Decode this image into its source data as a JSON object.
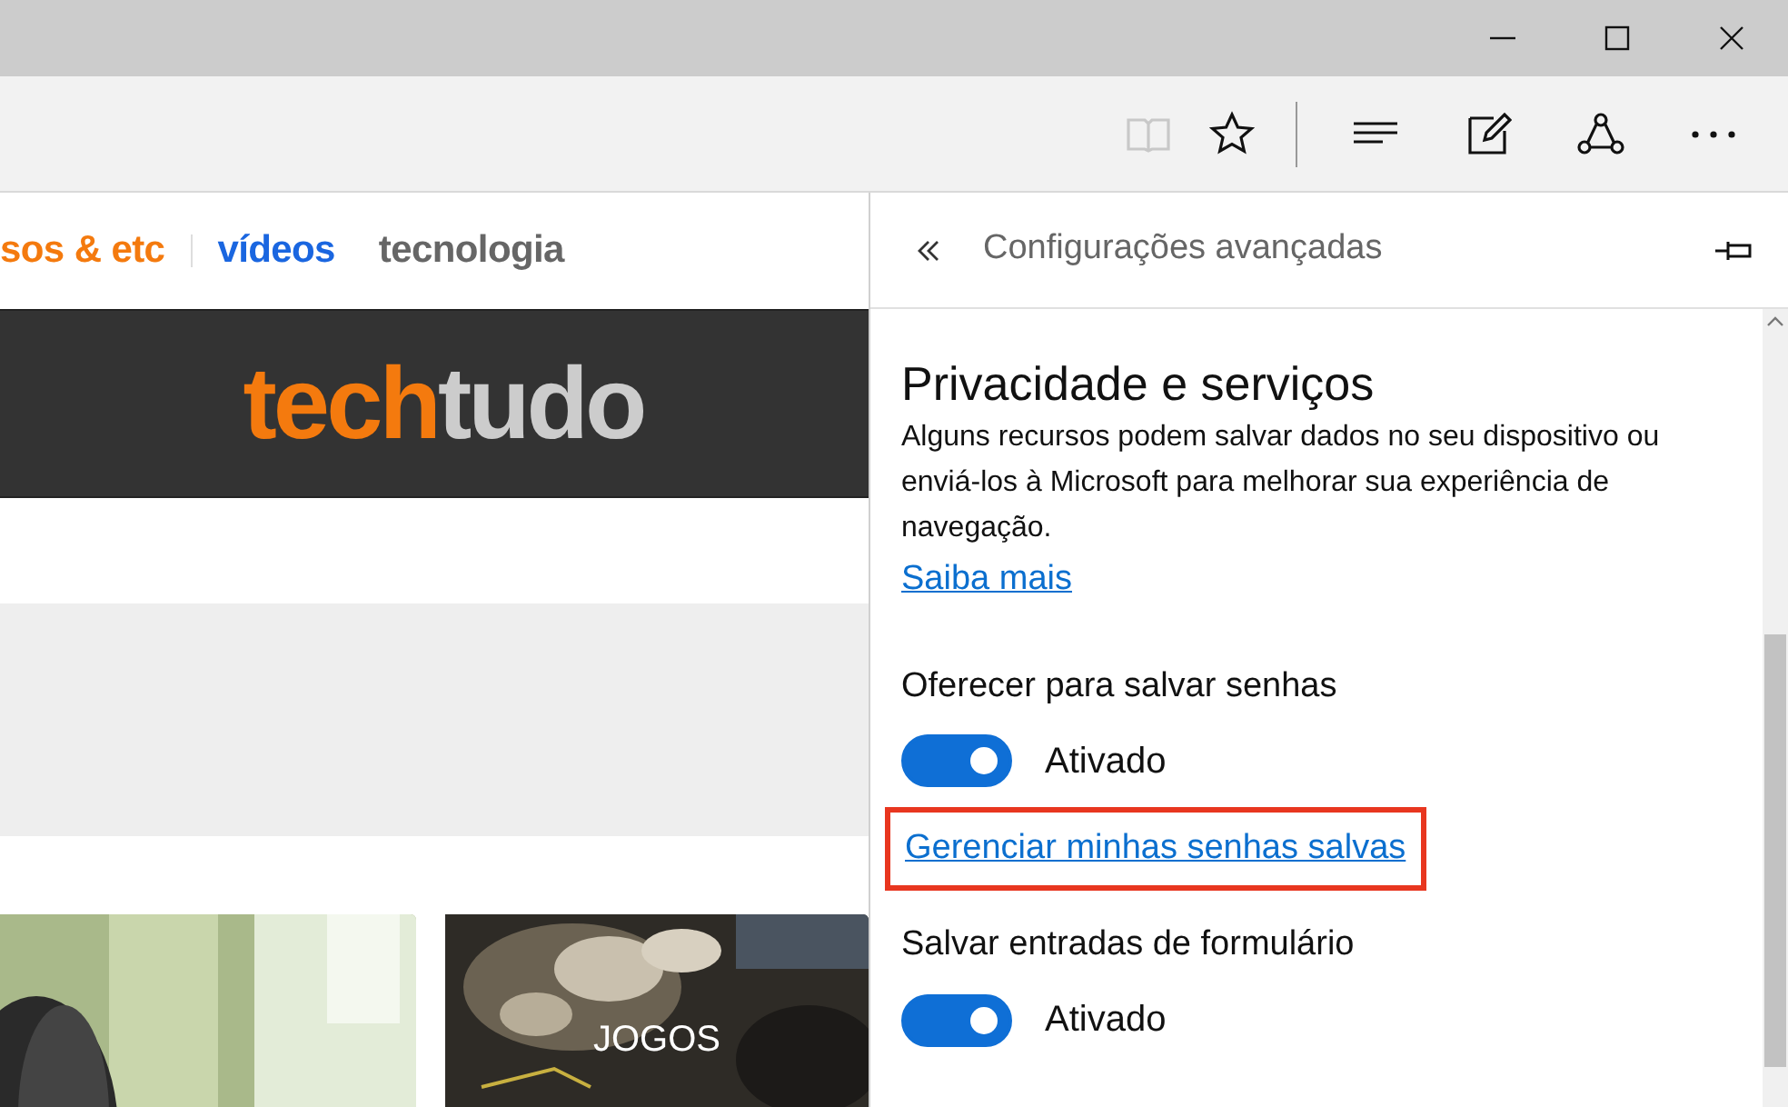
{
  "window": {
    "controls": [
      {
        "kind": "minimize"
      },
      {
        "kind": "maximize"
      },
      {
        "kind": "close"
      }
    ]
  },
  "toolbar": {
    "buttons": [
      {
        "kind": "reading",
        "disabled": true
      },
      {
        "kind": "favorite",
        "disabled": false
      },
      {
        "kind": "hub",
        "disabled": false
      },
      {
        "kind": "note",
        "disabled": false
      },
      {
        "kind": "share",
        "disabled": false
      },
      {
        "kind": "more",
        "disabled": false
      }
    ]
  },
  "page": {
    "nav": [
      {
        "label": "sos & etc",
        "color": "#f47a0e"
      },
      {
        "label": "vídeos",
        "color": "#1a66e0"
      },
      {
        "label": "tecnologia",
        "color": "#666666"
      }
    ],
    "logo": [
      {
        "text": "tech",
        "color": "#f47a0e"
      },
      {
        "text": "tudo",
        "color": "#cccccc"
      }
    ],
    "cards": [
      {
        "kind": "picture"
      },
      {
        "kind": "picture",
        "label": "JOGOS"
      }
    ]
  },
  "panel": {
    "title": "Configurações avançadas",
    "section_title": "Privacidade e serviços",
    "description": "Alguns recursos podem salvar dados no seu dispositivo ou enviá-los à Microsoft para melhorar sua experiência de navegação.",
    "learn_more": "Saiba mais",
    "settings": [
      {
        "label": "Oferecer para salvar senhas",
        "on": true,
        "state": "Ativado",
        "link": "Gerenciar minhas senhas salvas",
        "highlighted": true
      },
      {
        "label": "Salvar entradas de formulário",
        "on": true,
        "state": "Ativado"
      }
    ]
  }
}
